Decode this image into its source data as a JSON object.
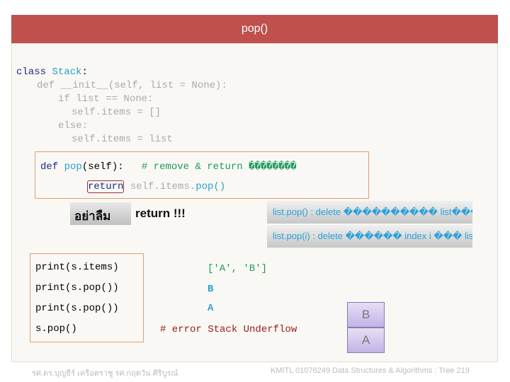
{
  "title": "pop()",
  "code": {
    "l1a": "class ",
    "l1b": "Stack",
    ":": ":",
    "l2": "def __init__(self, list = None):",
    "l3": "if list == None:",
    "l4": "self.items = []",
    "l5": "else:",
    "l6": "self.items = list",
    "def": "def ",
    "pop": "pop",
    "selfp": "(self):",
    "comment": "# remove & return ��������",
    "ret": "return",
    "retrest": " self.items.",
    "popcall": "pop()"
  },
  "reminder": {
    "thai": "อย่าลืม",
    "ret": "return !!!"
  },
  "notes": [
    "list.pop() : delete ���������� list�����",
    "list.pop(i) : delete ������ index i ��� list"
  ],
  "examples": [
    {
      "code": "print(s.items)",
      "output": "['A', 'B']"
    },
    {
      "code": "print(s.pop())",
      "output": "B"
    },
    {
      "code": "print(s.pop())",
      "output": "A"
    },
    {
      "code": "s.pop()",
      "output": "# error Stack Underflow"
    }
  ],
  "stack": [
    "B",
    "A"
  ],
  "footer": {
    "authors": "รศ.ดร.บุญธีร์ เครือตราชู   รศ.กฤตวัน ศิริบูรณ์",
    "course": "KMITL   01076249 Data Structures & Algorithms : Tree 219"
  }
}
